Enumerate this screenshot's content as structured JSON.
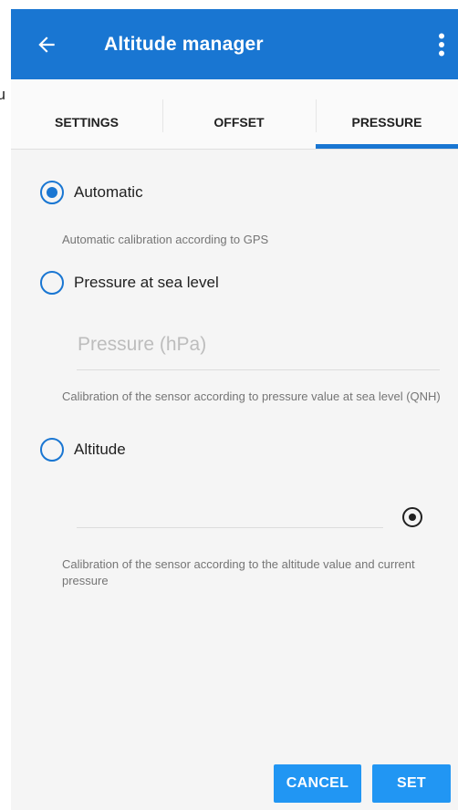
{
  "header": {
    "title": "Altitude manager",
    "back_icon": "arrow-left-icon",
    "menu_icon": "more-vert-icon",
    "color": "#1976d2"
  },
  "stray_text": "u",
  "tabs": [
    {
      "label": "SETTINGS",
      "selected": false
    },
    {
      "label": "OFFSET",
      "selected": false
    },
    {
      "label": "PRESSURE",
      "selected": true
    }
  ],
  "options": {
    "automatic": {
      "label": "Automatic",
      "selected": true,
      "description": "Automatic calibration according to GPS"
    },
    "sea_level": {
      "label": "Pressure at sea level",
      "selected": false,
      "placeholder": "Pressure (hPa)",
      "description": "Calibration of the sensor according to pressure value at sea level (QNH)"
    },
    "altitude": {
      "label": "Altitude",
      "selected": false,
      "value": "",
      "gps_icon": "gps-fix-icon",
      "description": "Calibration of the sensor according to the altitude value and current pressure"
    }
  },
  "actions": {
    "cancel_label": "CANCEL",
    "set_label": "SET",
    "button_color": "#2196f3"
  }
}
